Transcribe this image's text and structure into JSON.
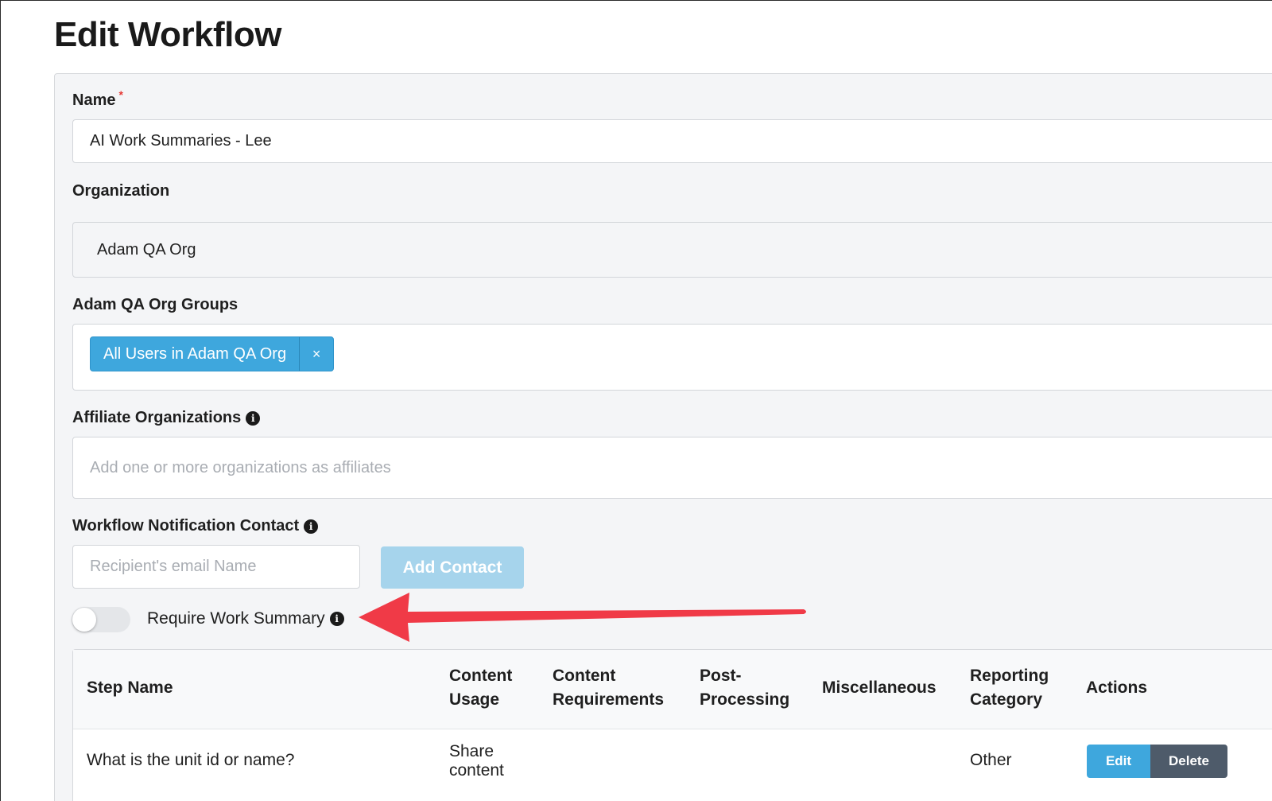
{
  "page": {
    "title": "Edit Workflow"
  },
  "form": {
    "name": {
      "label": "Name",
      "required_mark": "*",
      "value": "AI Work Summaries - Lee"
    },
    "organization": {
      "label": "Organization",
      "value": "Adam QA Org"
    },
    "groups": {
      "label": "Adam QA Org Groups",
      "tags": [
        {
          "label": "All Users in Adam QA Org",
          "remove": "×"
        }
      ]
    },
    "affiliates": {
      "label": "Affiliate Organizations",
      "placeholder": "Add one or more organizations as affiliates"
    },
    "notification": {
      "label": "Workflow Notification Contact",
      "email_placeholder": "Recipient's email Name",
      "add_button": "Add Contact"
    },
    "work_summary": {
      "label": "Require Work Summary",
      "enabled": false
    }
  },
  "table": {
    "headers": {
      "step_name": "Step Name",
      "content_usage_1": "Content",
      "content_usage_2": "Usage",
      "content_req_1": "Content",
      "content_req_2": "Requirements",
      "post_proc_1": "Post-",
      "post_proc_2": "Processing",
      "misc": "Miscellaneous",
      "reporting_1": "Reporting",
      "reporting_2": "Category",
      "actions": "Actions"
    },
    "rows": [
      {
        "step_name": "What is the unit id or name?",
        "content_usage_1": "Share",
        "content_usage_2": "content",
        "reporting_category": "Other",
        "edit": "Edit",
        "delete": "Delete"
      }
    ]
  },
  "icons": {
    "info": "info-icon",
    "close": "close-icon"
  },
  "colors": {
    "accent": "#3ea7dd",
    "arrow": "#f03a47",
    "delete": "#4e5b6a"
  }
}
